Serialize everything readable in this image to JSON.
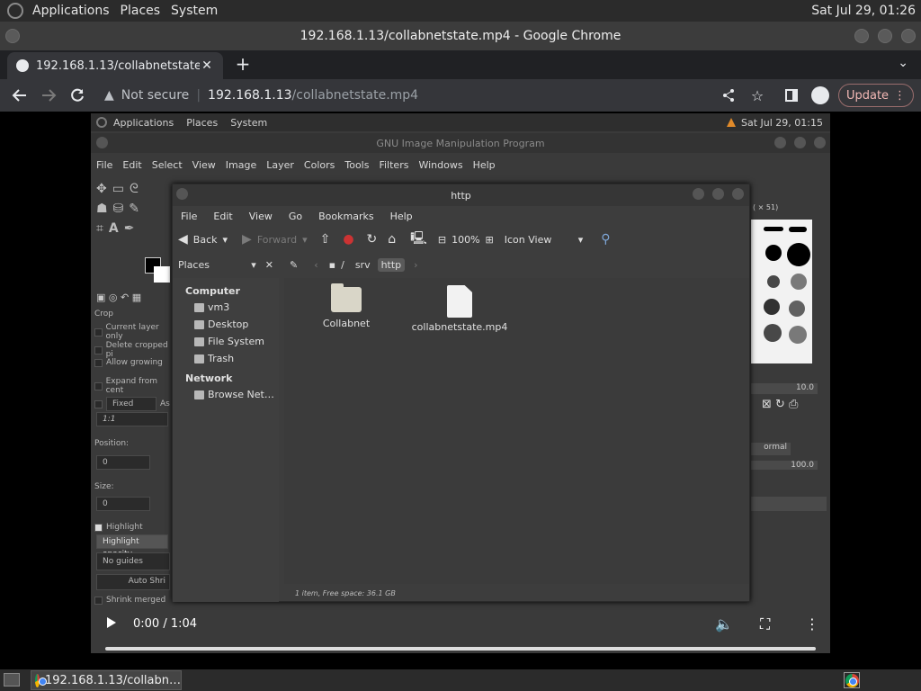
{
  "desktop_panel": {
    "menus": [
      "Applications",
      "Places",
      "System"
    ],
    "clock": "Sat Jul 29, 01:26"
  },
  "chrome": {
    "window_title": "192.168.1.13/collabnetstate.mp4 - Google Chrome",
    "tab_title": "192.168.1.13/collabnetstate.mp",
    "omnibox": {
      "security": "Not secure",
      "host": "192.168.1.13",
      "path": "/collabnetstate.mp4"
    },
    "update_label": "Update",
    "icons": [
      "back-icon",
      "forward-icon",
      "reload-icon",
      "share-icon",
      "star-icon",
      "sidebar-icon",
      "profile-icon",
      "menu-icon"
    ]
  },
  "video": {
    "inner_panel": {
      "menus": [
        "Applications",
        "Places",
        "System"
      ],
      "clock": "Sat Jul 29, 01:15"
    },
    "gimp": {
      "title": "GNU Image Manipulation Program",
      "menu": [
        "File",
        "Edit",
        "Select",
        "View",
        "Image",
        "Layer",
        "Colors",
        "Tools",
        "Filters",
        "Windows",
        "Help"
      ],
      "tool_options": {
        "heading": "Crop",
        "current_layer_only": "Current layer only",
        "delete_cropped": "Delete cropped pi",
        "allow_growing": "Allow growing",
        "expand_from_center": "Expand from cent",
        "fixed": "Fixed",
        "aspect": "As",
        "ratio": "1:1",
        "position_label": "Position:",
        "position_x": "0",
        "size_label": "Size:",
        "size_x": "0",
        "highlight": "Highlight",
        "highlight_opacity": "Highlight opacity",
        "guides": "No guides",
        "auto_shrink": "Auto Shri",
        "shrink_merged": "Shrink merged"
      },
      "right_dock": {
        "brush_header": "( × 51)",
        "spacing": "10.0",
        "mode": "ormal",
        "opacity": "100.0"
      }
    },
    "file_manager": {
      "title": "http",
      "menu": [
        "File",
        "Edit",
        "View",
        "Go",
        "Bookmarks",
        "Help"
      ],
      "toolbar": {
        "back": "Back",
        "forward": "Forward",
        "zoom": "100%",
        "view_mode": "Icon View"
      },
      "path": [
        "/",
        "srv",
        "http"
      ],
      "sidebar": {
        "header": "Places",
        "computer_label": "Computer",
        "computer_items": [
          "vm3",
          "Desktop",
          "File System",
          "Trash"
        ],
        "network_label": "Network",
        "network_items": [
          "Browse Net…"
        ]
      },
      "items": [
        {
          "name": "Collabnet",
          "kind": "folder"
        },
        {
          "name": "collabnetstate.mp4",
          "kind": "file"
        }
      ],
      "status": "1 item, Free space: 36.1 GB"
    },
    "player": {
      "time": "0:00 / 1:04",
      "progress": 0.0
    }
  },
  "taskbar": {
    "chrome_task": "192.168.1.13/collabn…"
  }
}
